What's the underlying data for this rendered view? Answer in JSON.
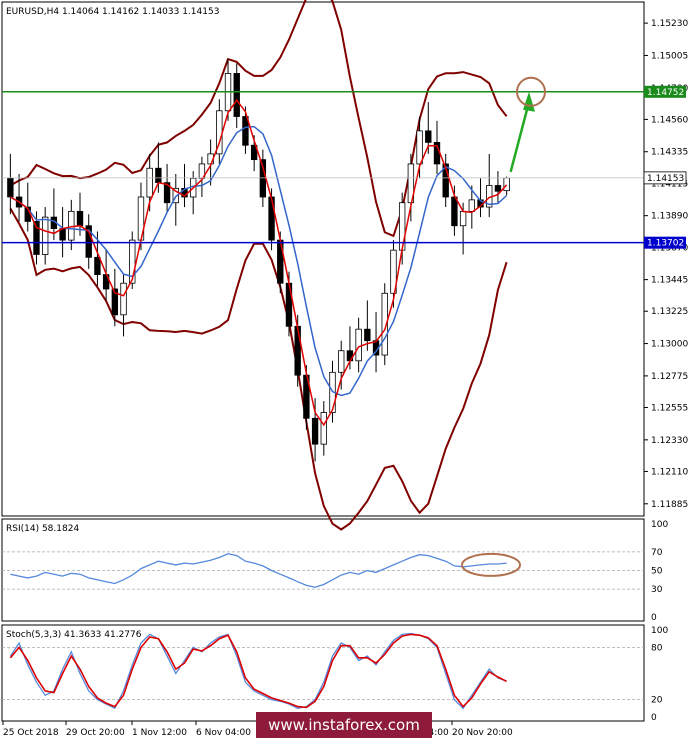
{
  "chart_data": {
    "type": "candlestick",
    "symbol_header": "EURUSD,H4  1.14064 1.14162 1.14033 1.14153",
    "price_axis": {
      "ticks": [
        "1.15230",
        "1.15005",
        "1.14780",
        "1.14560",
        "1.14335",
        "1.14115",
        "1.13890",
        "1.13670",
        "1.13445",
        "1.13225",
        "1.13000",
        "1.12775",
        "1.12555",
        "1.12330",
        "1.12110",
        "1.11885"
      ],
      "ylim": [
        1.118,
        1.1537
      ]
    },
    "x_axis_labels": [
      "25 Oct 2018",
      "29 Oct 20:00",
      "1 Nov 12:00",
      "6 Nov 04:00",
      "8 Nov 20:00",
      "13 Nov 12:00",
      "16 Nov 04:00",
      "20 Nov 20:00"
    ],
    "resistance_level": {
      "label": "1.14752",
      "value": 1.14752,
      "color": "#1a8a1a"
    },
    "support_level": {
      "label": "1.13702",
      "value": 1.13702,
      "color": "#0000cc"
    },
    "current_price": {
      "label": "1.14153",
      "value": 1.14153
    },
    "candles_ohlc": [
      [
        1.1415,
        1.1432,
        1.139,
        1.1402
      ],
      [
        1.1402,
        1.1418,
        1.1385,
        1.1395
      ],
      [
        1.1395,
        1.1412,
        1.1378,
        1.1385
      ],
      [
        1.1385,
        1.1392,
        1.1355,
        1.1362
      ],
      [
        1.1362,
        1.1395,
        1.1355,
        1.1388
      ],
      [
        1.1388,
        1.1408,
        1.1372,
        1.138
      ],
      [
        1.138,
        1.1395,
        1.136,
        1.1372
      ],
      [
        1.1372,
        1.14,
        1.1365,
        1.1392
      ],
      [
        1.1392,
        1.1405,
        1.1375,
        1.1382
      ],
      [
        1.1382,
        1.139,
        1.1352,
        1.136
      ],
      [
        1.136,
        1.1378,
        1.134,
        1.1348
      ],
      [
        1.1348,
        1.1365,
        1.133,
        1.1338
      ],
      [
        1.1338,
        1.1352,
        1.1312,
        1.132
      ],
      [
        1.132,
        1.1348,
        1.1305,
        1.1342
      ],
      [
        1.1342,
        1.1378,
        1.1338,
        1.1372
      ],
      [
        1.1372,
        1.1412,
        1.1365,
        1.1402
      ],
      [
        1.1402,
        1.1432,
        1.1392,
        1.1422
      ],
      [
        1.1422,
        1.144,
        1.1405,
        1.1412
      ],
      [
        1.1412,
        1.1425,
        1.1392,
        1.1398
      ],
      [
        1.1398,
        1.1418,
        1.1382,
        1.1408
      ],
      [
        1.1408,
        1.1425,
        1.1395,
        1.1402
      ],
      [
        1.1402,
        1.142,
        1.139,
        1.1415
      ],
      [
        1.1415,
        1.143,
        1.1402,
        1.1425
      ],
      [
        1.1425,
        1.1442,
        1.141,
        1.1432
      ],
      [
        1.1432,
        1.147,
        1.1425,
        1.1462
      ],
      [
        1.1462,
        1.1498,
        1.1455,
        1.1488
      ],
      [
        1.1488,
        1.1495,
        1.145,
        1.1458
      ],
      [
        1.1458,
        1.1465,
        1.1432,
        1.1438
      ],
      [
        1.1438,
        1.1445,
        1.142,
        1.1428
      ],
      [
        1.1428,
        1.1435,
        1.1395,
        1.1402
      ],
      [
        1.1402,
        1.1408,
        1.1365,
        1.1372
      ],
      [
        1.1372,
        1.1378,
        1.1335,
        1.1342
      ],
      [
        1.1342,
        1.135,
        1.1305,
        1.1312
      ],
      [
        1.1312,
        1.132,
        1.127,
        1.1278
      ],
      [
        1.1278,
        1.1285,
        1.124,
        1.1248
      ],
      [
        1.1248,
        1.1262,
        1.1218,
        1.123
      ],
      [
        1.123,
        1.126,
        1.1222,
        1.1252
      ],
      [
        1.1252,
        1.1288,
        1.1245,
        1.128
      ],
      [
        1.128,
        1.1302,
        1.1268,
        1.1295
      ],
      [
        1.1295,
        1.1312,
        1.1282,
        1.1288
      ],
      [
        1.1288,
        1.1318,
        1.128,
        1.131
      ],
      [
        1.131,
        1.133,
        1.1295,
        1.1302
      ],
      [
        1.1302,
        1.1322,
        1.128,
        1.1292
      ],
      [
        1.1292,
        1.1342,
        1.1285,
        1.1335
      ],
      [
        1.1335,
        1.1372,
        1.1325,
        1.1365
      ],
      [
        1.1365,
        1.1405,
        1.1355,
        1.1398
      ],
      [
        1.1398,
        1.1432,
        1.1385,
        1.1425
      ],
      [
        1.1425,
        1.1458,
        1.1415,
        1.1448
      ],
      [
        1.1448,
        1.1468,
        1.1432,
        1.144
      ],
      [
        1.144,
        1.1455,
        1.1418,
        1.1425
      ],
      [
        1.1425,
        1.1432,
        1.1395,
        1.1402
      ],
      [
        1.1402,
        1.141,
        1.1375,
        1.1382
      ],
      [
        1.1382,
        1.1398,
        1.1362,
        1.1392
      ],
      [
        1.1392,
        1.141,
        1.138,
        1.14
      ],
      [
        1.14,
        1.1415,
        1.1388,
        1.1395
      ],
      [
        1.1395,
        1.1432,
        1.1388,
        1.141
      ],
      [
        1.141,
        1.142,
        1.1398,
        1.1406
      ],
      [
        1.14064,
        1.14162,
        1.14033,
        1.14153
      ]
    ],
    "indicators": {
      "bollinger_upper_color": "#800000",
      "bollinger_lower_color": "#800000",
      "fast_ma_color": "#e00000",
      "slow_ma_color": "#3366cc"
    },
    "annotations": {
      "arrow_color": "#22aa22",
      "ellipse_color": "#b07050"
    },
    "rsi": {
      "label": "RSI(14) 58.1824",
      "ticks": [
        "100",
        "70",
        "50",
        "30",
        "0"
      ],
      "color": "#5588dd",
      "values": [
        46,
        44,
        42,
        44,
        48,
        46,
        44,
        47,
        46,
        42,
        40,
        38,
        36,
        40,
        45,
        52,
        56,
        60,
        58,
        56,
        58,
        57,
        59,
        61,
        64,
        68,
        66,
        60,
        58,
        55,
        50,
        46,
        42,
        38,
        34,
        32,
        35,
        40,
        45,
        48,
        46,
        50,
        48,
        52,
        56,
        60,
        64,
        67,
        66,
        63,
        60,
        55,
        54,
        55,
        56,
        57,
        57,
        58
      ]
    },
    "stoch": {
      "label": "Stoch(5,3,3) 41.3633 41.2776",
      "ticks": [
        "100",
        "80",
        "20",
        "0"
      ],
      "main_color": "#5588dd",
      "signal_color": "#dd0000",
      "main": [
        70,
        85,
        60,
        40,
        25,
        30,
        55,
        75,
        50,
        30,
        20,
        15,
        10,
        30,
        60,
        85,
        95,
        90,
        70,
        50,
        65,
        80,
        75,
        85,
        92,
        95,
        70,
        40,
        30,
        25,
        20,
        18,
        15,
        10,
        12,
        20,
        40,
        70,
        85,
        80,
        65,
        70,
        60,
        75,
        88,
        95,
        96,
        94,
        90,
        80,
        50,
        20,
        10,
        25,
        40,
        55,
        45,
        41
      ],
      "signal": [
        68,
        80,
        65,
        45,
        30,
        28,
        50,
        70,
        55,
        35,
        22,
        16,
        12,
        25,
        55,
        80,
        92,
        90,
        75,
        55,
        62,
        78,
        76,
        82,
        90,
        94,
        75,
        45,
        32,
        27,
        22,
        19,
        16,
        12,
        11,
        18,
        35,
        65,
        82,
        82,
        68,
        68,
        62,
        72,
        85,
        93,
        95,
        94,
        91,
        82,
        55,
        25,
        12,
        22,
        38,
        52,
        46,
        41
      ]
    }
  },
  "watermark": "www.instaforex.com"
}
